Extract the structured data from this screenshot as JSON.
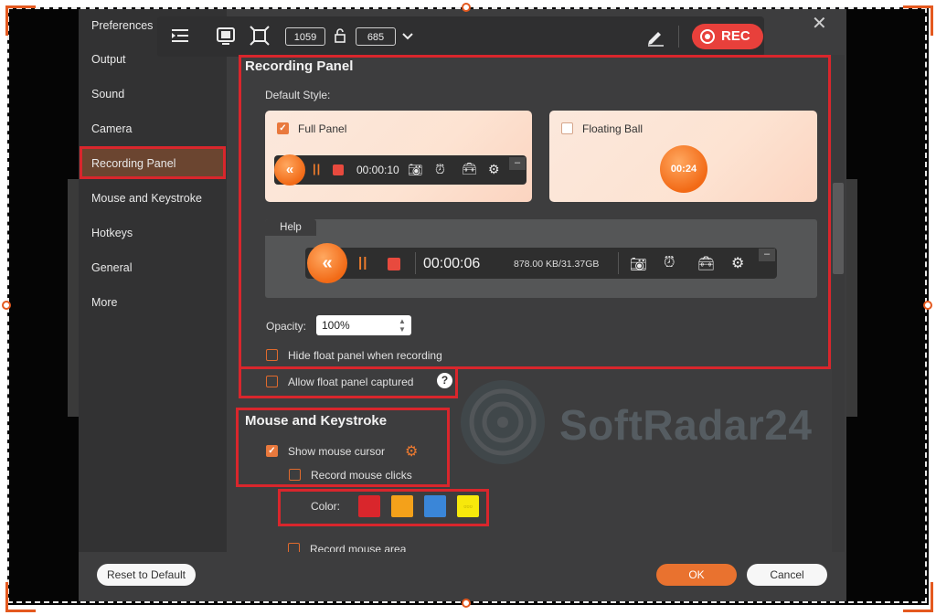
{
  "sidebar": {
    "items": [
      {
        "label": "Preferences"
      },
      {
        "label": "Output"
      },
      {
        "label": "Sound"
      },
      {
        "label": "Camera"
      },
      {
        "label": "Recording Panel"
      },
      {
        "label": "Mouse and Keystroke"
      },
      {
        "label": "Hotkeys"
      },
      {
        "label": "General"
      },
      {
        "label": "More"
      }
    ],
    "active": "Recording Panel"
  },
  "toolbar": {
    "width_value": "1059",
    "height_value": "685",
    "rec_label": "REC"
  },
  "recording_panel": {
    "title": "Recording Panel",
    "default_style_label": "Default Style:",
    "full_panel": {
      "label": "Full Panel",
      "checked": true,
      "timer": "00:00:10"
    },
    "floating_ball": {
      "label": "Floating Ball",
      "checked": false,
      "timer": "00:24"
    },
    "help": {
      "tab": "Help",
      "timer": "00:00:06",
      "size": "878.00 KB/31.37GB"
    },
    "opacity": {
      "label": "Opacity:",
      "value": "100%"
    },
    "hide_float": {
      "label": "Hide float panel when recording",
      "checked": false
    },
    "allow_float": {
      "label": "Allow float panel captured",
      "checked": false
    }
  },
  "mouse_keystroke": {
    "title": "Mouse and Keystroke",
    "show_cursor": {
      "label": "Show mouse cursor",
      "checked": true
    },
    "record_clicks": {
      "label": "Record mouse clicks",
      "checked": false
    },
    "color_label": "Color:",
    "colors": [
      "#d9262c",
      "#f4a11a",
      "#3a86d8",
      "#f7e80b"
    ],
    "next_item_partial": "Record mouse area"
  },
  "footer": {
    "reset_label": "Reset to Default",
    "ok_label": "OK",
    "cancel_label": "Cancel"
  },
  "watermark": "SoftRadar24"
}
